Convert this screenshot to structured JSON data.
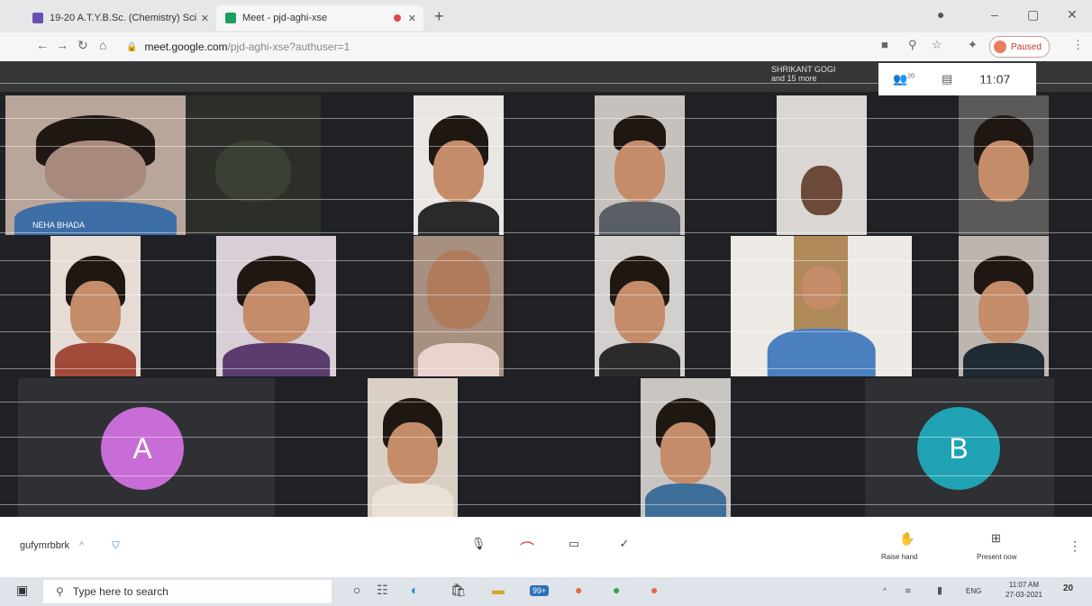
{
  "browser": {
    "tabs": [
      {
        "title": "19-20 A.T.Y.B.Sc. (Chemistry) Sci"
      },
      {
        "title": "Meet - pjd-aghi-xse"
      }
    ],
    "url_host": "meet.google.com",
    "url_path": "/pjd-aghi-xse?authuser=1",
    "profile_status": "Paused"
  },
  "meet": {
    "presenter_label": "SHRIKANT GOGI",
    "others_label": "and 15 more",
    "participant_count": "20",
    "clock": "11:07",
    "tile_name": "NEHA BHADA",
    "avatar_a": "A",
    "avatar_b": "B",
    "meeting_code": "gufymrbbrk",
    "raise_hand": "Raise hand",
    "present_now": "Present now",
    "colors": {
      "avatar_a": "#c86dd7",
      "avatar_b": "#1fa3b4",
      "end_call": "#d93025"
    }
  },
  "taskbar": {
    "search_placeholder": "Type here to search",
    "badge": "99+",
    "language": "ENG",
    "time": "11:07 AM",
    "date": "27-03-2021",
    "notifications": "20"
  }
}
